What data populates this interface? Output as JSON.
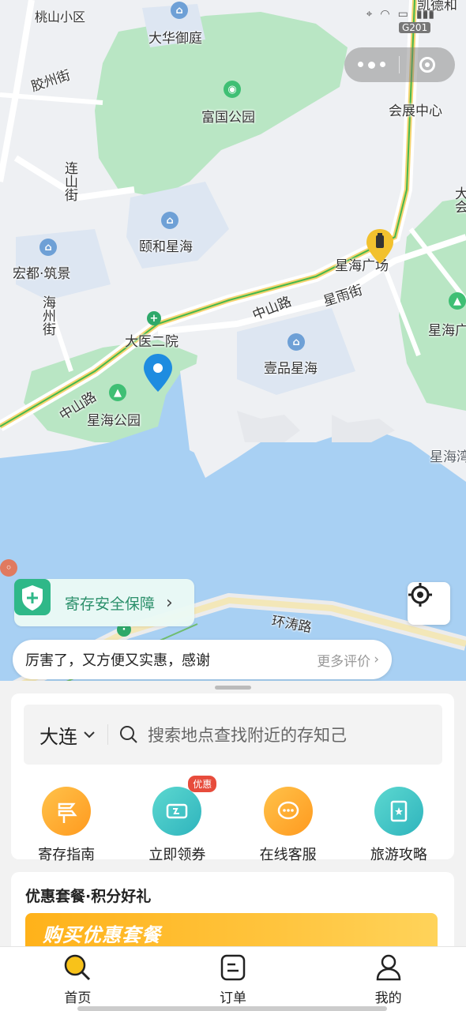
{
  "map": {
    "labels": {
      "tl_poi": "桃山小区",
      "dahuayuting": "大华御庭",
      "jiaozhou_st": "胶州街",
      "fuguo_park": "富国公园",
      "lianshan_st": "连山街",
      "convention_center": "会展中心",
      "g201": "G201",
      "da_hui": "大会",
      "yihe_xinghai": "颐和星海",
      "hongdu_zhujing": "宏都·筑景",
      "xinghai_square": "星海广场",
      "zhongshan_road_1": "中山路",
      "xingyu_st": "星雨街",
      "haizhou_st": "海州街",
      "xinghai_right": "星海广",
      "dayi_erqyuan": "大医二院",
      "yipin_xinghai": "壹品星海",
      "zhongshan_road_2": "中山路",
      "xinghai_park": "星海公园",
      "xinghai_bay": "星海湾",
      "huantao_road": "环涛路",
      "top_right_partial": "凯德和"
    }
  },
  "capsule": {
    "more_icon": "more-dots-icon",
    "close_icon": "target-circle-icon"
  },
  "safety": {
    "label": "寄存安全保障"
  },
  "review": {
    "quote": "厉害了，又方便又实惠，感谢",
    "more": "更多评价"
  },
  "search": {
    "city": "大连",
    "placeholder": "搜索地点查找附近的存知己"
  },
  "quick_actions": [
    {
      "label": "寄存指南",
      "icon": "signpost-icon",
      "color": "#ffab2e"
    },
    {
      "label": "立即领券",
      "icon": "ticket-icon",
      "color": "#39c4c0",
      "badge": "优惠"
    },
    {
      "label": "在线客服",
      "icon": "chat-icon",
      "color": "#ffab2e"
    },
    {
      "label": "旅游攻略",
      "icon": "guidebook-icon",
      "color": "#39c4c0"
    }
  ],
  "promo": {
    "title": "优惠套餐·积分好礼",
    "banner": "购买优惠套餐"
  },
  "tabs": [
    {
      "label": "首页",
      "icon": "search-home-icon",
      "active": true
    },
    {
      "label": "订单",
      "icon": "order-icon",
      "active": false
    },
    {
      "label": "我的",
      "icon": "profile-icon",
      "active": false
    }
  ]
}
